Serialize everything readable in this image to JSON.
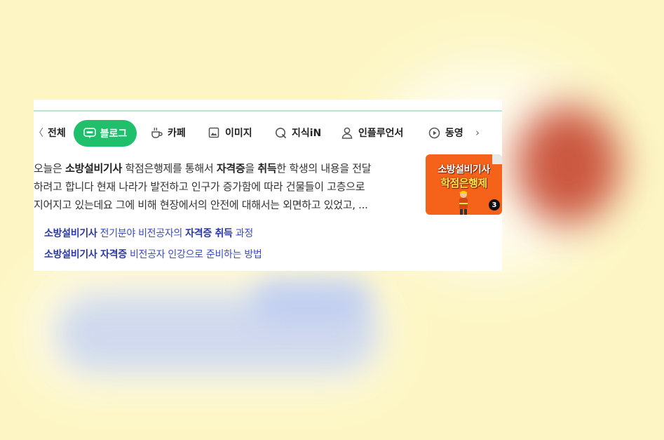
{
  "tabs": {
    "all": "전체",
    "blog": "블로그",
    "cafe": "카페",
    "image": "이미지",
    "kin": "지식iN",
    "influencer": "인플루언서",
    "video": "동영"
  },
  "snippet": {
    "l1_a": "오늘은 ",
    "l1_b": "소방설비기사",
    "l1_c": " 학점은행제를 통해서 ",
    "l1_d": "자격증",
    "l1_e": "을 ",
    "l1_f": "취득",
    "l1_g": "한 학생의 내용을 전달",
    "l2": "하려고 합니다 현재 나라가 발전하고 인구가 증가함에 따라 건물들이 고층으로",
    "l3": "지어지고 있는데요 그에 비해 현장에서의 안전에 대해서는 외면하고 있었고, ..."
  },
  "thumbnail": {
    "title_line1": "소방설비기사",
    "title_line2": "학점은행제",
    "badge": "3"
  },
  "related": [
    {
      "a": "소방설비기사",
      "b": " 전기분야 비전공자의 ",
      "c": "자격증 취득",
      "d": " 과정"
    },
    {
      "a": "소방설비기사 자격증",
      "b": " 비전공자 인강으로 준비하는 방법"
    }
  ],
  "colors": {
    "accent_green": "#20bf6b",
    "link_blue": "#3b4dbd",
    "background": "#fdf6c4"
  },
  "icons": [
    "chevron-left-icon",
    "blog-icon",
    "cafe-cup-icon",
    "image-icon",
    "kin-q-icon",
    "person-icon",
    "play-icon",
    "chevron-right-icon"
  ]
}
